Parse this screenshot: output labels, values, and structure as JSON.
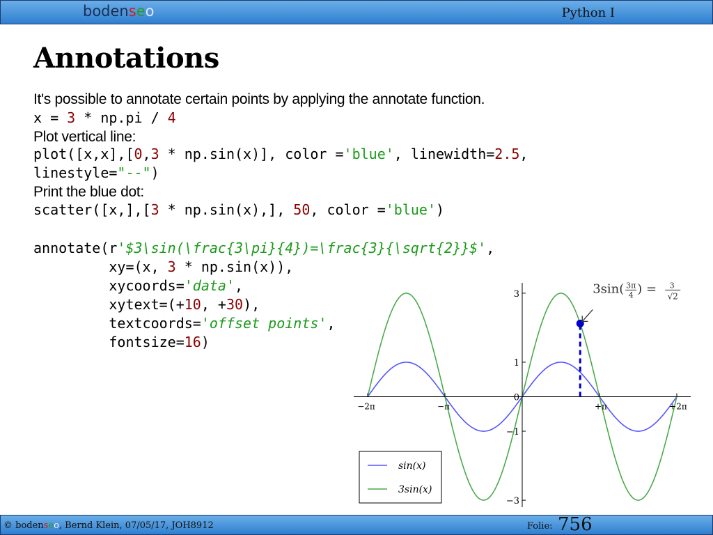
{
  "header": {
    "logo": {
      "b": "boden",
      "s": "s",
      "e": "e",
      "o": "o"
    },
    "course": "Python I"
  },
  "slide": {
    "title": "Annotations",
    "intro": "It's possible to annotate certain points by applying the annotate function.",
    "line_x": {
      "a": "x = ",
      "b": "3",
      "c": " * np.pi / ",
      "d": "4"
    },
    "plot_vertical_label": "Plot vertical line:",
    "plot_line1": {
      "a": "plot([x,x],[",
      "b": "0",
      "c": ",",
      "d": "3",
      "e": " * np.sin(x)], color =",
      "f": "'blue'",
      "g": ", linewidth=",
      "h": "2.5",
      "i": ","
    },
    "plot_line2": {
      "a": "linestyle=",
      "b": "\"--\"",
      "c": ")"
    },
    "print_dot_label": "Print the blue dot:",
    "scatter_line": {
      "a": "scatter([x,],[",
      "b": "3",
      "c": " * np.sin(x),], ",
      "d": "50",
      "e": ", color =",
      "f": "'blue'",
      "g": ")"
    },
    "annotate_line1": {
      "a": "annotate(r",
      "b": "'$3\\sin(\\frac{3\\pi}{4})=\\frac{3}{\\sqrt{2}}$'",
      "c": ","
    },
    "annotate_line2": {
      "a": "         xy=(x, ",
      "b": "3",
      "c": " * np.sin(x)),",
      "d": ""
    },
    "annotate_line3": {
      "a": "         xycoords=",
      "b": "'data'",
      "c": ","
    },
    "annotate_line4": {
      "a": "         xytext=(+",
      "b": "10",
      "c": ", +",
      "d": "30",
      "e": "),"
    },
    "annotate_line5": {
      "a": "         textcoords=",
      "b": "'offset points'",
      "c": ","
    },
    "annotate_line6": {
      "a": "         fontsize=",
      "b": "16",
      "c": ")"
    }
  },
  "footer": {
    "copyright": "© ",
    "name_tail": ", Bernd Klein, 07/05/17, JOH8912",
    "folio_label": "Folie:",
    "page_number": "756"
  },
  "chart_data": {
    "type": "line",
    "x_range": [
      -6.2832,
      6.2832
    ],
    "xlim": [
      -6.85,
      6.85
    ],
    "ylim": [
      -3.2,
      3.3
    ],
    "x_tick_labels": [
      "−2π",
      "−π",
      "+π",
      "+2π"
    ],
    "y_tick_labels": [
      "3",
      "1",
      "0",
      "−1",
      "−3"
    ],
    "series": [
      {
        "name": "sin(x)",
        "color": "#5555ff",
        "amplitude": 1,
        "points": [
          [
            -6.2832,
            0
          ],
          [
            -4.7124,
            1
          ],
          [
            -3.1416,
            0
          ],
          [
            -1.5708,
            -1
          ],
          [
            0,
            0
          ],
          [
            1.5708,
            1
          ],
          [
            3.1416,
            0
          ],
          [
            4.7124,
            -1
          ],
          [
            6.2832,
            0
          ]
        ]
      },
      {
        "name": "3sin(x)",
        "color": "#4caa4c",
        "amplitude": 3,
        "points": [
          [
            -6.2832,
            0
          ],
          [
            -4.7124,
            3
          ],
          [
            -3.1416,
            0
          ],
          [
            -1.5708,
            -3
          ],
          [
            0,
            0
          ],
          [
            1.5708,
            3
          ],
          [
            3.1416,
            0
          ],
          [
            4.7124,
            -3
          ],
          [
            6.2832,
            0
          ]
        ]
      }
    ],
    "vertical_line": {
      "x": 2.3562,
      "y_from": 0,
      "y_to": 2.1213,
      "color": "#0000cc",
      "style": "dashed"
    },
    "marker": {
      "x": 2.3562,
      "y": 2.1213,
      "color": "#0000cc"
    },
    "annotation": {
      "lead": "3sin(",
      "frac_top": "3π",
      "frac_bottom": "4",
      "mid": ") = ",
      "rhs_top": "3",
      "rhs_bottom": "√2",
      "target_x": 2.3562,
      "target_y": 2.1213
    },
    "legend_position": "lower-left"
  }
}
